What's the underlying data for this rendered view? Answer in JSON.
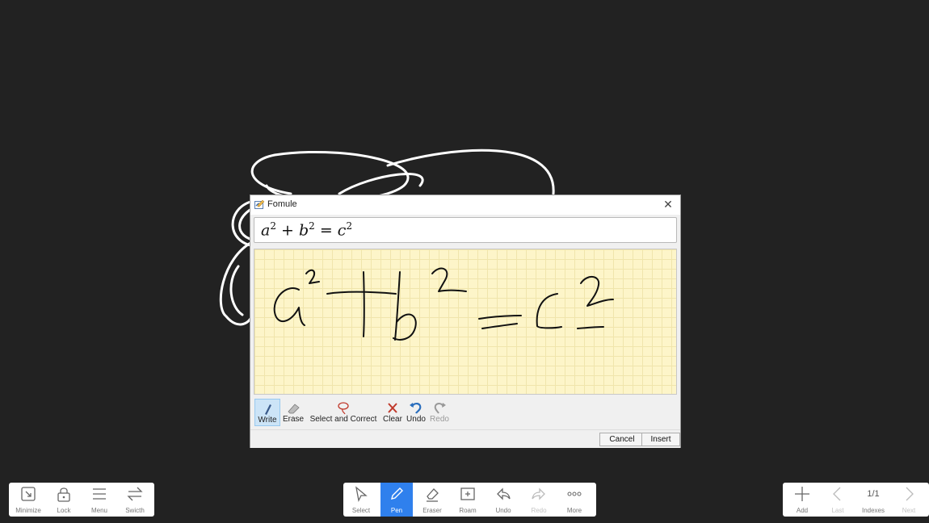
{
  "dialog": {
    "title": "Fomule",
    "formula": {
      "a": "a",
      "b": "b",
      "c": "c",
      "exp": "2",
      "plus": " + ",
      "equals": " = "
    },
    "tools": [
      {
        "label": "Write"
      },
      {
        "label": "Erase"
      },
      {
        "label": "Select and Correct"
      },
      {
        "label": "Clear"
      },
      {
        "label": "Undo"
      },
      {
        "label": "Redo"
      }
    ],
    "cancel_label": "Cancel",
    "insert_label": "Insert"
  },
  "left_bar": {
    "items": [
      {
        "label": "Minimize",
        "icon": "minimize-icon"
      },
      {
        "label": "Lock",
        "icon": "lock-icon"
      },
      {
        "label": "Menu",
        "icon": "menu-icon"
      },
      {
        "label": "Swicth",
        "icon": "switch-icon"
      }
    ]
  },
  "center_bar": {
    "items": [
      {
        "label": "Select",
        "icon": "cursor-icon"
      },
      {
        "label": "Pen",
        "icon": "pen-icon"
      },
      {
        "label": "Eraser",
        "icon": "eraser-icon"
      },
      {
        "label": "Roam",
        "icon": "roam-icon"
      },
      {
        "label": "Undo",
        "icon": "undo-icon"
      },
      {
        "label": "Redo",
        "icon": "redo-icon"
      },
      {
        "label": "More",
        "icon": "more-icon"
      }
    ]
  },
  "right_bar": {
    "items": [
      {
        "label": "Add",
        "icon": "plus-icon"
      },
      {
        "label": "Last",
        "icon": "chevron-left-icon"
      },
      {
        "label": "Indexes"
      },
      {
        "label": "Next",
        "icon": "chevron-right-icon"
      }
    ],
    "page_indicator": "1/1"
  },
  "colors": {
    "background": "#222222",
    "accent": "#2f80ed",
    "ink_area": "#fdf5c9"
  }
}
